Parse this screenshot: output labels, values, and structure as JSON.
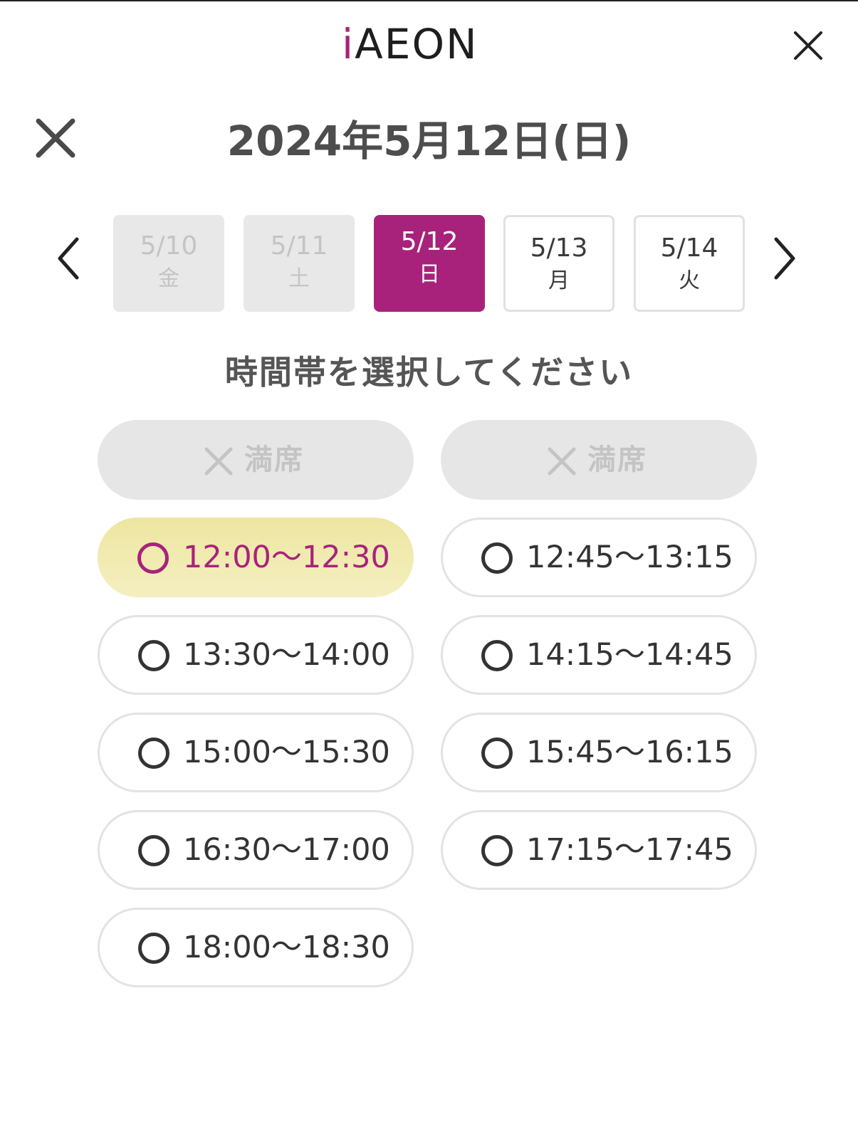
{
  "header": {
    "logo_i": "i",
    "logo_text": "AEON",
    "close_icon": "close-icon"
  },
  "modal": {
    "close_icon": "close-icon",
    "date_title": "2024年5月12日(日)"
  },
  "date_nav": {
    "prev_icon": "chevron-left-icon",
    "next_icon": "chevron-right-icon",
    "dates": [
      {
        "date": "5/10",
        "weekday": "金",
        "state": "disabled"
      },
      {
        "date": "5/11",
        "weekday": "土",
        "state": "disabled"
      },
      {
        "date": "5/12",
        "weekday": "日",
        "state": "selected"
      },
      {
        "date": "5/13",
        "weekday": "月",
        "state": "available"
      },
      {
        "date": "5/14",
        "weekday": "火",
        "state": "available"
      }
    ]
  },
  "slots_section": {
    "prompt": "時間帯を選択してください",
    "full_label": "満席",
    "slots": [
      {
        "label": "満席",
        "state": "full"
      },
      {
        "label": "満席",
        "state": "full"
      },
      {
        "label": "12:00〜12:30",
        "state": "selected"
      },
      {
        "label": "12:45〜13:15",
        "state": "available"
      },
      {
        "label": "13:30〜14:00",
        "state": "available"
      },
      {
        "label": "14:15〜14:45",
        "state": "available"
      },
      {
        "label": "15:00〜15:30",
        "state": "available"
      },
      {
        "label": "15:45〜16:15",
        "state": "available"
      },
      {
        "label": "16:30〜17:00",
        "state": "available"
      },
      {
        "label": "17:15〜17:45",
        "state": "available"
      },
      {
        "label": "18:00〜18:30",
        "state": "available"
      }
    ]
  },
  "colors": {
    "brand": "#a8227b",
    "selected_slot": "#efe9a8",
    "disabled": "#e6e6e6"
  }
}
